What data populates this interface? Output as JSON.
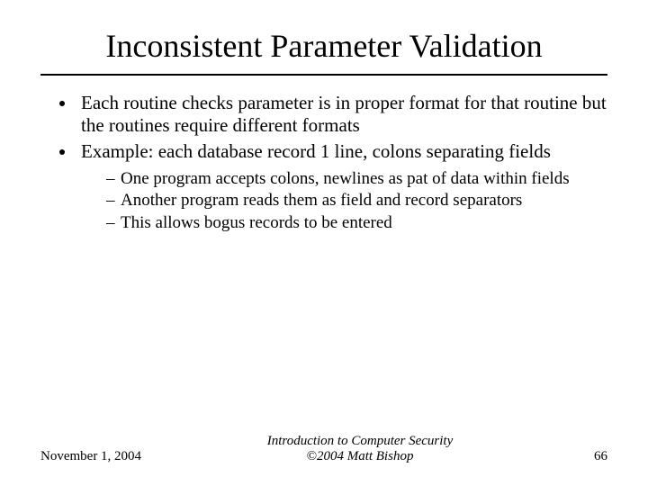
{
  "title": "Inconsistent Parameter Validation",
  "bullets": [
    "Each routine checks parameter is in proper format for that routine but the routines require different formats",
    "Example: each database record 1 line, colons separating fields"
  ],
  "subbullets": [
    "One program accepts colons, newlines as pat of data within fields",
    "Another program reads them as field and record separators",
    "This allows bogus records to be entered"
  ],
  "footer": {
    "date": "November 1, 2004",
    "center_line1": "Introduction to Computer Security",
    "center_line2": "©2004 Matt Bishop",
    "page": "66"
  }
}
